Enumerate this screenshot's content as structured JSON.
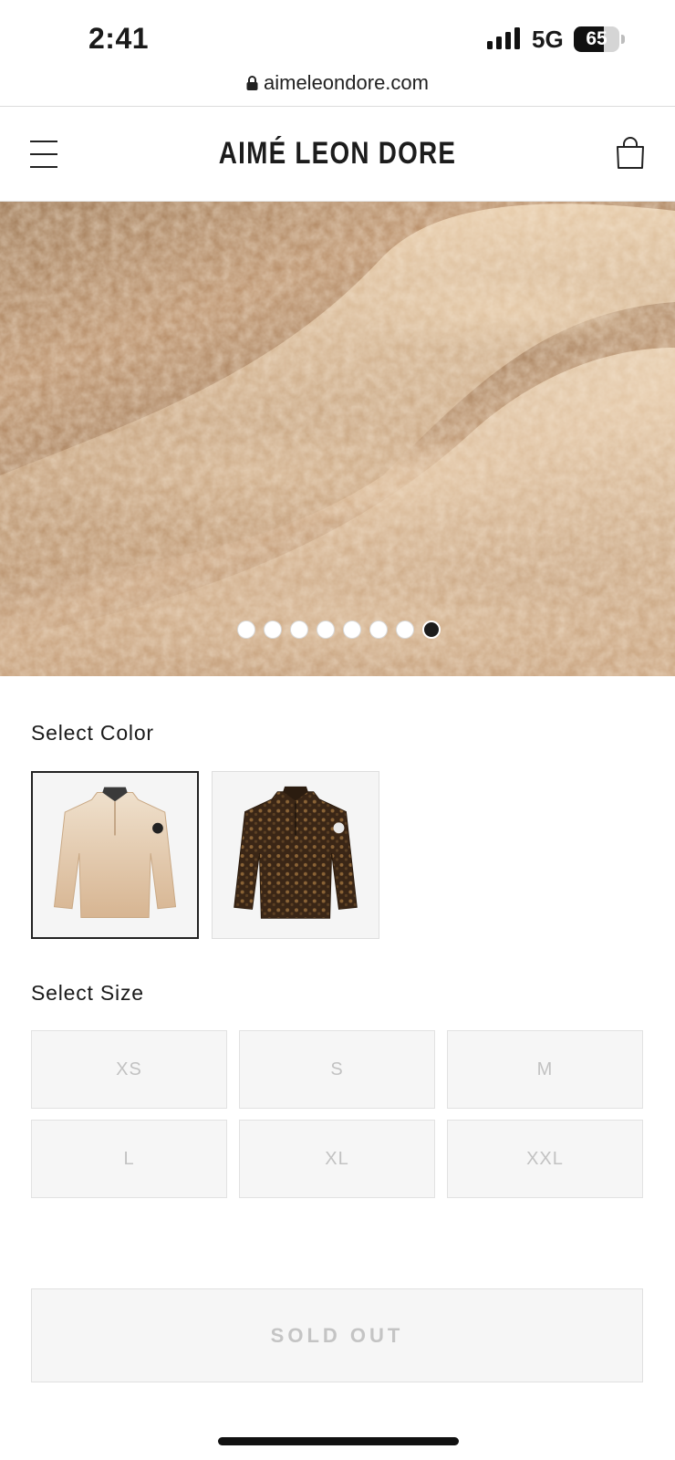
{
  "status_bar": {
    "time": "2:41",
    "network": "5G",
    "battery_level": "65",
    "battery_fraction": 0.65,
    "icons": [
      "signal-icon",
      "battery-icon"
    ]
  },
  "browser": {
    "url": "aimeleondore.com",
    "icons": [
      "lock-icon"
    ]
  },
  "header": {
    "brand": "AIMÉ LEON DORE",
    "icons": [
      "menu-icon",
      "shopping-bag-icon"
    ]
  },
  "gallery": {
    "image": "sherpa fleece close-up",
    "slide_count": 8,
    "active_index": 7
  },
  "color": {
    "label": "Select Color",
    "options": [
      {
        "name": "beige ombre sherpa half-zip",
        "selected": true,
        "color": "#e6cdae"
      },
      {
        "name": "brown leopard sherpa half-zip",
        "selected": false,
        "color": "#3a2616"
      }
    ]
  },
  "size": {
    "label": "Select Size",
    "options": [
      "XS",
      "S",
      "M",
      "L",
      "XL",
      "XXL"
    ],
    "available": false
  },
  "cta": {
    "label": "SOLD OUT"
  },
  "colors": {
    "text": "#1a1a1a",
    "disabled_text": "#c2c2c2",
    "disabled_bg": "#f6f6f6",
    "border": "#e2e2e2"
  }
}
